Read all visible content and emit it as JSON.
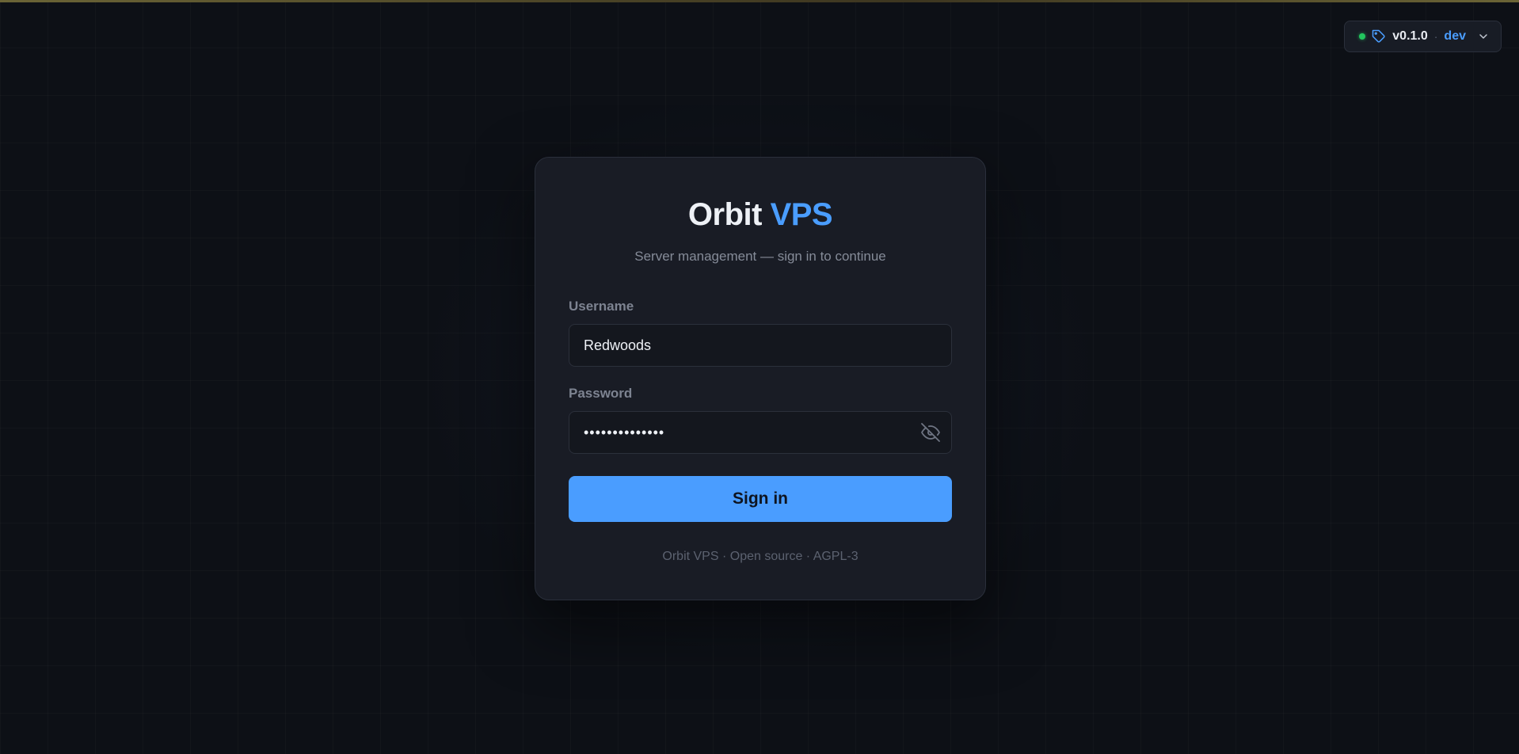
{
  "version_badge": {
    "status_color": "#22c55e",
    "version": "v0.1.0",
    "separator": "·",
    "environment": "dev",
    "icons": [
      "tag-icon",
      "chevron-down-icon"
    ]
  },
  "login": {
    "brand_name": "Orbit",
    "brand_accent": "VPS",
    "subtitle": "Server management — sign in to continue",
    "username_label": "Username",
    "username_value": "Redwoods",
    "password_label": "Password",
    "password_value": "••••••••••••••",
    "password_toggle_icon": "eye-off-icon",
    "submit_label": "Sign in",
    "footer": "Orbit VPS · Open source · AGPL-3"
  },
  "colors": {
    "accent": "#4a9dff",
    "background": "#0d1016",
    "card": "#191c25"
  }
}
